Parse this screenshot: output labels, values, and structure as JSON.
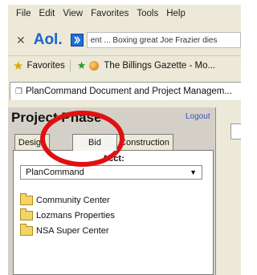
{
  "menu": [
    "File",
    "Edit",
    "View",
    "Favorites",
    "Tools",
    "Help"
  ],
  "aol": {
    "close_glyph": "✕",
    "logo": "Aol.",
    "ticker": "ent ... Boxing great Joe Frazier dies"
  },
  "favorites": {
    "label": "Favorites",
    "link": "The Billings Gazette - Mo..."
  },
  "browser_tab": {
    "title": "PlanCommand Document and Project Managem..."
  },
  "project": {
    "title": "Project Phase",
    "logout": "Logout",
    "tabs": [
      "Design",
      "Bid",
      "Construction"
    ],
    "active_tab": "Bid",
    "account_label": "Acct:",
    "account_value": "PlanCommand",
    "folders": [
      "Community Center",
      "Lozmans Properties",
      "NSA Super Center"
    ]
  },
  "colors": {
    "highlight_ring": "#e01010",
    "aol_blue": "#1a63c7",
    "folder": "#f3d565"
  },
  "icons": {
    "favorites": "star-icon",
    "add_favorite": "add-favorite-icon",
    "folder": "folder-icon",
    "dropdown": "chevron-down-icon"
  }
}
